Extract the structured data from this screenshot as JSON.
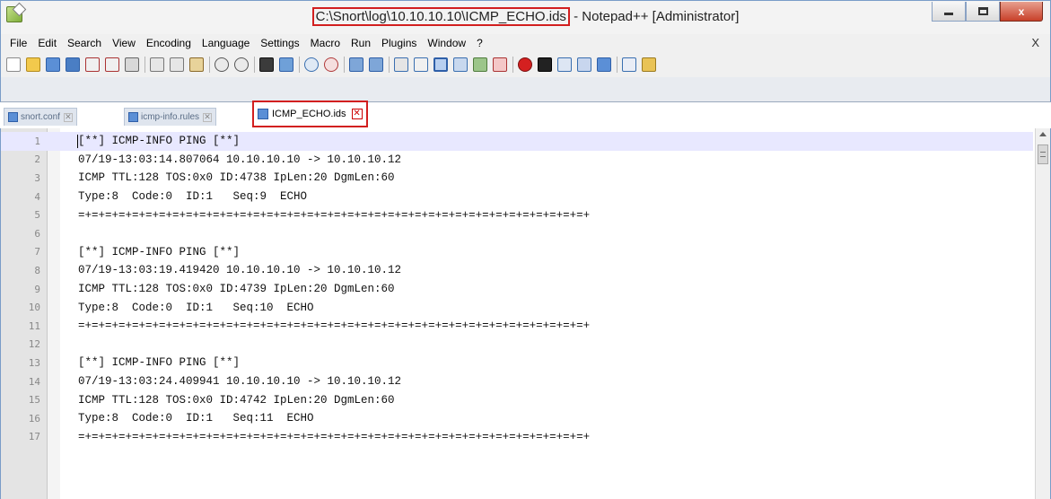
{
  "window": {
    "title_path": "C:\\Snort\\log\\10.10.10.10\\ICMP_ECHO.ids",
    "title_suffix": " - Notepad++ [Administrator]",
    "close_label": "x"
  },
  "menu": {
    "items": [
      "File",
      "Edit",
      "Search",
      "View",
      "Encoding",
      "Language",
      "Settings",
      "Macro",
      "Run",
      "Plugins",
      "Window",
      "?"
    ],
    "close_label": "X"
  },
  "tabs": [
    {
      "label": "snort.conf",
      "close": "✕"
    },
    {
      "label": "icmp-info.rules",
      "close": "✕"
    },
    {
      "label": "ICMP_ECHO.ids",
      "close": "✕"
    }
  ],
  "editor": {
    "lines": [
      {
        "num": "1",
        "text": "[**] ICMP-INFO PING [**]"
      },
      {
        "num": "2",
        "text": "07/19-13:03:14.807064 10.10.10.10 -> 10.10.10.12"
      },
      {
        "num": "3",
        "text": "ICMP TTL:128 TOS:0x0 ID:4738 IpLen:20 DgmLen:60"
      },
      {
        "num": "4",
        "text": "Type:8  Code:0  ID:1   Seq:9  ECHO"
      },
      {
        "num": "5",
        "text": "=+=+=+=+=+=+=+=+=+=+=+=+=+=+=+=+=+=+=+=+=+=+=+=+=+=+=+=+=+=+=+=+=+=+=+=+=+=+"
      },
      {
        "num": "6",
        "text": ""
      },
      {
        "num": "7",
        "text": "[**] ICMP-INFO PING [**]"
      },
      {
        "num": "8",
        "text": "07/19-13:03:19.419420 10.10.10.10 -> 10.10.10.12"
      },
      {
        "num": "9",
        "text": "ICMP TTL:128 TOS:0x0 ID:4739 IpLen:20 DgmLen:60"
      },
      {
        "num": "10",
        "text": "Type:8  Code:0  ID:1   Seq:10  ECHO"
      },
      {
        "num": "11",
        "text": "=+=+=+=+=+=+=+=+=+=+=+=+=+=+=+=+=+=+=+=+=+=+=+=+=+=+=+=+=+=+=+=+=+=+=+=+=+=+"
      },
      {
        "num": "12",
        "text": ""
      },
      {
        "num": "13",
        "text": "[**] ICMP-INFO PING [**]"
      },
      {
        "num": "14",
        "text": "07/19-13:03:24.409941 10.10.10.10 -> 10.10.10.12"
      },
      {
        "num": "15",
        "text": "ICMP TTL:128 TOS:0x0 ID:4742 IpLen:20 DgmLen:60"
      },
      {
        "num": "16",
        "text": "Type:8  Code:0  ID:1   Seq:11  ECHO"
      },
      {
        "num": "17",
        "text": "=+=+=+=+=+=+=+=+=+=+=+=+=+=+=+=+=+=+=+=+=+=+=+=+=+=+=+=+=+=+=+=+=+=+=+=+=+=+"
      }
    ]
  },
  "colors": {
    "highlight_red": "#d21f1f",
    "current_line": "#e8e8ff",
    "gutter": "#e4e4e4"
  }
}
